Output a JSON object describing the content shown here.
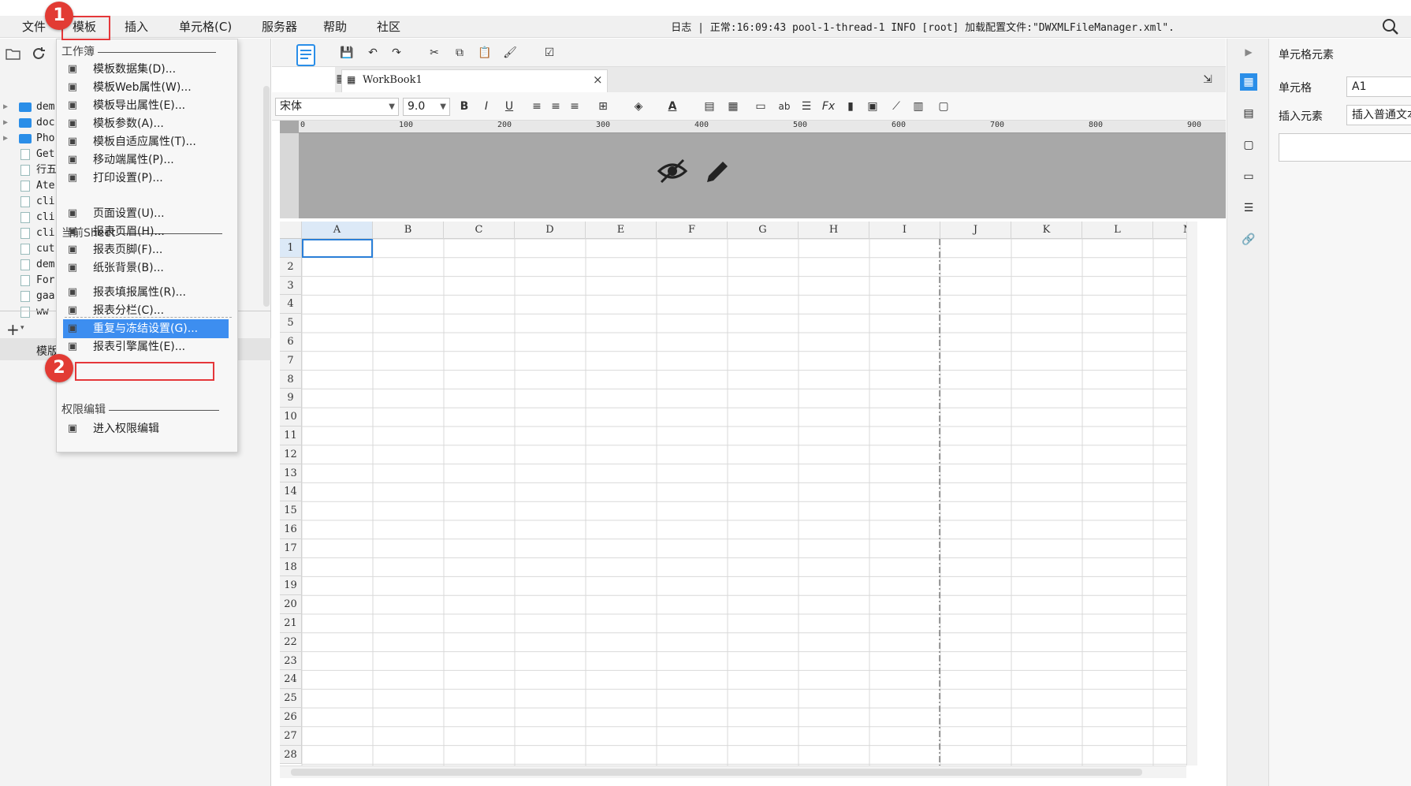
{
  "menubar": {
    "items": [
      "文件",
      "模板",
      "插入",
      "单元格(C)",
      "服务器",
      "帮助",
      "社区"
    ]
  },
  "status": {
    "log_label": "日志",
    "text": "正常:16:09:43 pool-1-thread-1 INFO [root] 加载配置文件:\"DWXMLFileManager.xml\"."
  },
  "tree": {
    "items": [
      "dem",
      "doc",
      "Pho",
      "Get",
      "行五",
      "Ate",
      "cli",
      "cli",
      "cli",
      "cut",
      "dem",
      "For",
      "gaa",
      "ww"
    ]
  },
  "left": {
    "bottom_label": "模版"
  },
  "template_menu": {
    "section_workbook": "工作簿",
    "workbook_items": [
      {
        "label": "模板数据集(D)...",
        "icon": "database-icon"
      },
      {
        "label": "模板Web属性(W)...",
        "icon": "globe-icon"
      },
      {
        "label": "模板导出属性(E)...",
        "icon": "export-icon"
      },
      {
        "label": "模板参数(A)...",
        "icon": "parameter-icon"
      },
      {
        "label": "模板自适应属性(T)...",
        "icon": "adaptive-icon"
      },
      {
        "label": "移动端属性(P)...",
        "icon": "mobile-icon"
      },
      {
        "label": "打印设置(P)...",
        "icon": "printer-icon"
      }
    ],
    "section_sheet": "当前Sheet",
    "sheet_items": [
      {
        "label": "页面设置(U)...",
        "icon": "page-setup-icon"
      },
      {
        "label": "报表页眉(H)...",
        "icon": "header-icon"
      },
      {
        "label": "报表页脚(F)...",
        "icon": "footer-icon"
      },
      {
        "label": "纸张背景(B)...",
        "icon": "background-image-icon"
      },
      {
        "label": "报表填报属性(R)...",
        "icon": "fill-attr-icon"
      },
      {
        "label": "报表分栏(C)...",
        "icon": "columns-icon"
      },
      {
        "label": "重复与冻结设置(G)...",
        "icon": "freeze-icon"
      },
      {
        "label": "报表引擎属性(E)...",
        "icon": "engine-icon"
      }
    ],
    "section_permission": "权限编辑",
    "permission_items": [
      {
        "label": "进入权限编辑",
        "icon": "permission-icon"
      }
    ]
  },
  "annotations": {
    "badge1": "1",
    "badge2": "2"
  },
  "editor": {
    "tab_name": "WorkBook1",
    "font_name": "宋体",
    "font_size": "9.0",
    "ruler_ticks": [
      "0",
      "100",
      "200",
      "300",
      "400",
      "500",
      "600",
      "700",
      "800",
      "900"
    ],
    "columns": [
      "A",
      "B",
      "C",
      "D",
      "E",
      "F",
      "G",
      "H",
      "I",
      "J",
      "K",
      "L",
      "M"
    ],
    "rows": [
      "1",
      "2",
      "3",
      "4",
      "5",
      "6",
      "7",
      "8",
      "9",
      "10",
      "11",
      "12",
      "13",
      "14",
      "15",
      "16",
      "17",
      "18",
      "19",
      "20",
      "21",
      "22",
      "23",
      "24",
      "25",
      "26",
      "27",
      "28"
    ]
  },
  "props": {
    "title": "单元格元素",
    "cell_label": "单元格",
    "cell_value": "A1",
    "insert_label": "插入元素",
    "insert_value": "插入普通文本"
  },
  "colors": {
    "accent": "#3d8ef0",
    "highlight": "#e5373a",
    "folder": "#2a8ee8"
  }
}
